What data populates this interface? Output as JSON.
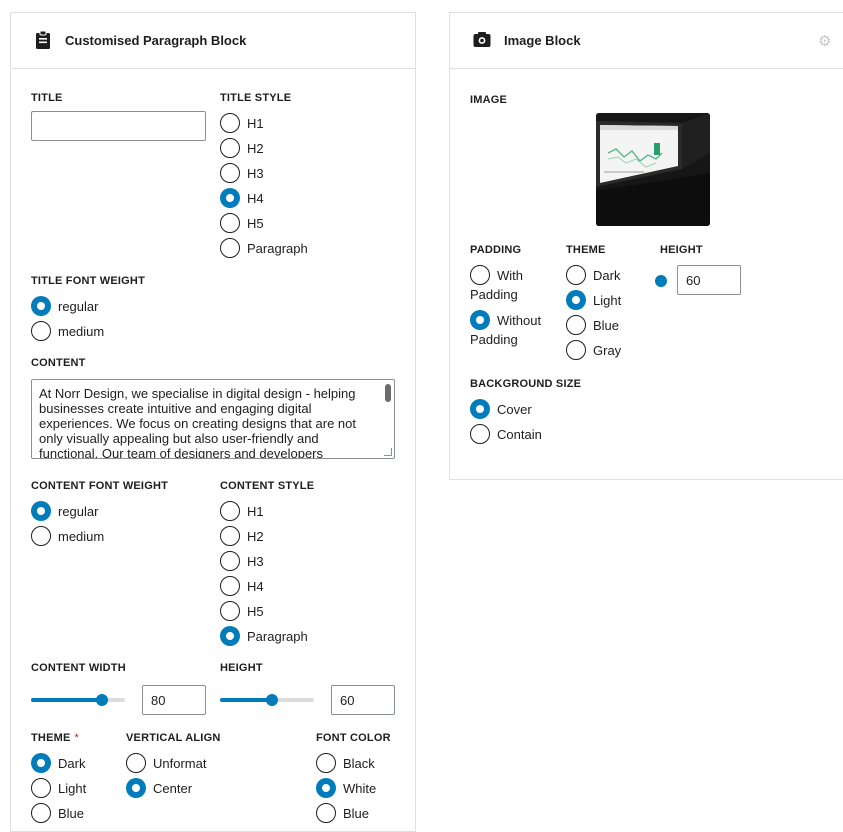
{
  "left_panel": {
    "title": "Customised Paragraph Block",
    "icon": "clipboard-icon",
    "title_label": "TITLE",
    "title_value": "",
    "title_style_label": "TITLE STYLE",
    "title_style_options": [
      {
        "label": "H1",
        "checked": false
      },
      {
        "label": "H2",
        "checked": false
      },
      {
        "label": "H3",
        "checked": false
      },
      {
        "label": "H4",
        "checked": true
      },
      {
        "label": "H5",
        "checked": false
      },
      {
        "label": "Paragraph",
        "checked": false
      }
    ],
    "title_font_weight_label": "TITLE FONT WEIGHT",
    "title_font_weight_options": [
      {
        "label": "regular",
        "checked": true
      },
      {
        "label": "medium",
        "checked": false
      }
    ],
    "content_label": "CONTENT",
    "content_value": "At Norr Design, we specialise in digital design - helping businesses create intuitive and engaging digital experiences. We focus on creating designs that are not only visually appealing but also user-friendly and functional. Our team of designers and developers",
    "content_font_weight_label": "CONTENT FONT WEIGHT",
    "content_font_weight_options": [
      {
        "label": "regular",
        "checked": true
      },
      {
        "label": "medium",
        "checked": false
      }
    ],
    "content_style_label": "CONTENT STYLE",
    "content_style_options": [
      {
        "label": "H1",
        "checked": false
      },
      {
        "label": "H2",
        "checked": false
      },
      {
        "label": "H3",
        "checked": false
      },
      {
        "label": "H4",
        "checked": false
      },
      {
        "label": "H5",
        "checked": false
      },
      {
        "label": "Paragraph",
        "checked": true
      }
    ],
    "content_width_label": "CONTENT WIDTH",
    "content_width_value": "80",
    "content_width_level": 0.75,
    "height_label": "HEIGHT",
    "height_value": "60",
    "height_level": 0.55,
    "theme_label": "THEME",
    "theme_required_mark": "*",
    "theme_options": [
      {
        "label": "Dark",
        "checked": true
      },
      {
        "label": "Light",
        "checked": false
      },
      {
        "label": "Blue",
        "checked": false
      }
    ],
    "vertical_align_label": "VERTICAL ALIGN",
    "vertical_align_options": [
      {
        "label": "Unformat",
        "checked": false
      },
      {
        "label": "Center",
        "checked": true
      }
    ],
    "font_color_label": "FONT COLOR",
    "font_color_options": [
      {
        "label": "Black",
        "checked": false
      },
      {
        "label": "White",
        "checked": true
      },
      {
        "label": "Blue",
        "checked": false
      }
    ]
  },
  "right_panel": {
    "title": "Image Block",
    "icon": "camera-icon",
    "settings_icon": "gear-icon",
    "image_label": "IMAGE",
    "padding_label": "PADDING",
    "padding_options": [
      {
        "label": "With",
        "sublabel": "Padding",
        "checked": false
      },
      {
        "label": "Without",
        "sublabel": "Padding",
        "checked": true
      }
    ],
    "theme_label": "THEME",
    "theme_options": [
      {
        "label": "Dark",
        "checked": false
      },
      {
        "label": "Light",
        "checked": true
      },
      {
        "label": "Blue",
        "checked": false
      },
      {
        "label": "Gray",
        "checked": false
      }
    ],
    "height_label": "HEIGHT",
    "height_value": "60",
    "background_size_label": "BACKGROUND SIZE",
    "background_size_options": [
      {
        "label": "Cover",
        "checked": true
      },
      {
        "label": "Contain",
        "checked": false
      }
    ]
  },
  "colors": {
    "accent": "#007cba",
    "border": "#e0e0e0",
    "text": "#1e1e1e",
    "required": "#cc1818"
  }
}
